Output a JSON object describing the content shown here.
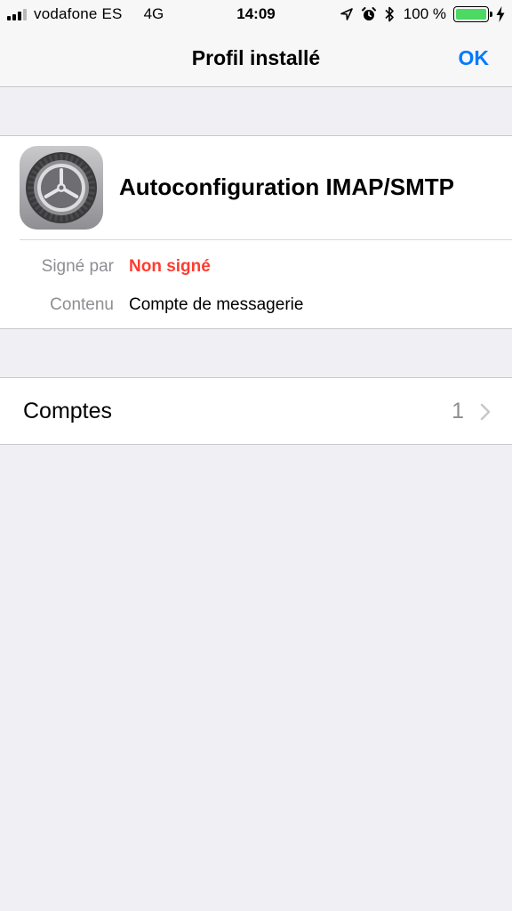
{
  "status_bar": {
    "carrier": "vodafone ES",
    "network": "4G",
    "time": "14:09",
    "battery_percent": "100 %",
    "signal_bars_filled": 3,
    "signal_bars_total": 4,
    "battery_level": 1.0,
    "icons": [
      "location-arrow-icon",
      "alarm-icon",
      "bluetooth-icon",
      "battery-icon",
      "charging-bolt-icon"
    ],
    "battery_color": "#4cd964"
  },
  "nav": {
    "title": "Profil installé",
    "done_label": "OK",
    "accent_color": "#007aff"
  },
  "profile": {
    "name": "Autoconfiguration IMAP/SMTP",
    "icon": "settings-gear-icon",
    "signed_by_label": "Signé par",
    "signed_by_value": "Non signé",
    "signed_by_color": "#ff3b30",
    "content_label": "Contenu",
    "content_value": "Compte de messagerie"
  },
  "accounts": {
    "label": "Comptes",
    "count": "1",
    "icon": "chevron-right-icon"
  }
}
